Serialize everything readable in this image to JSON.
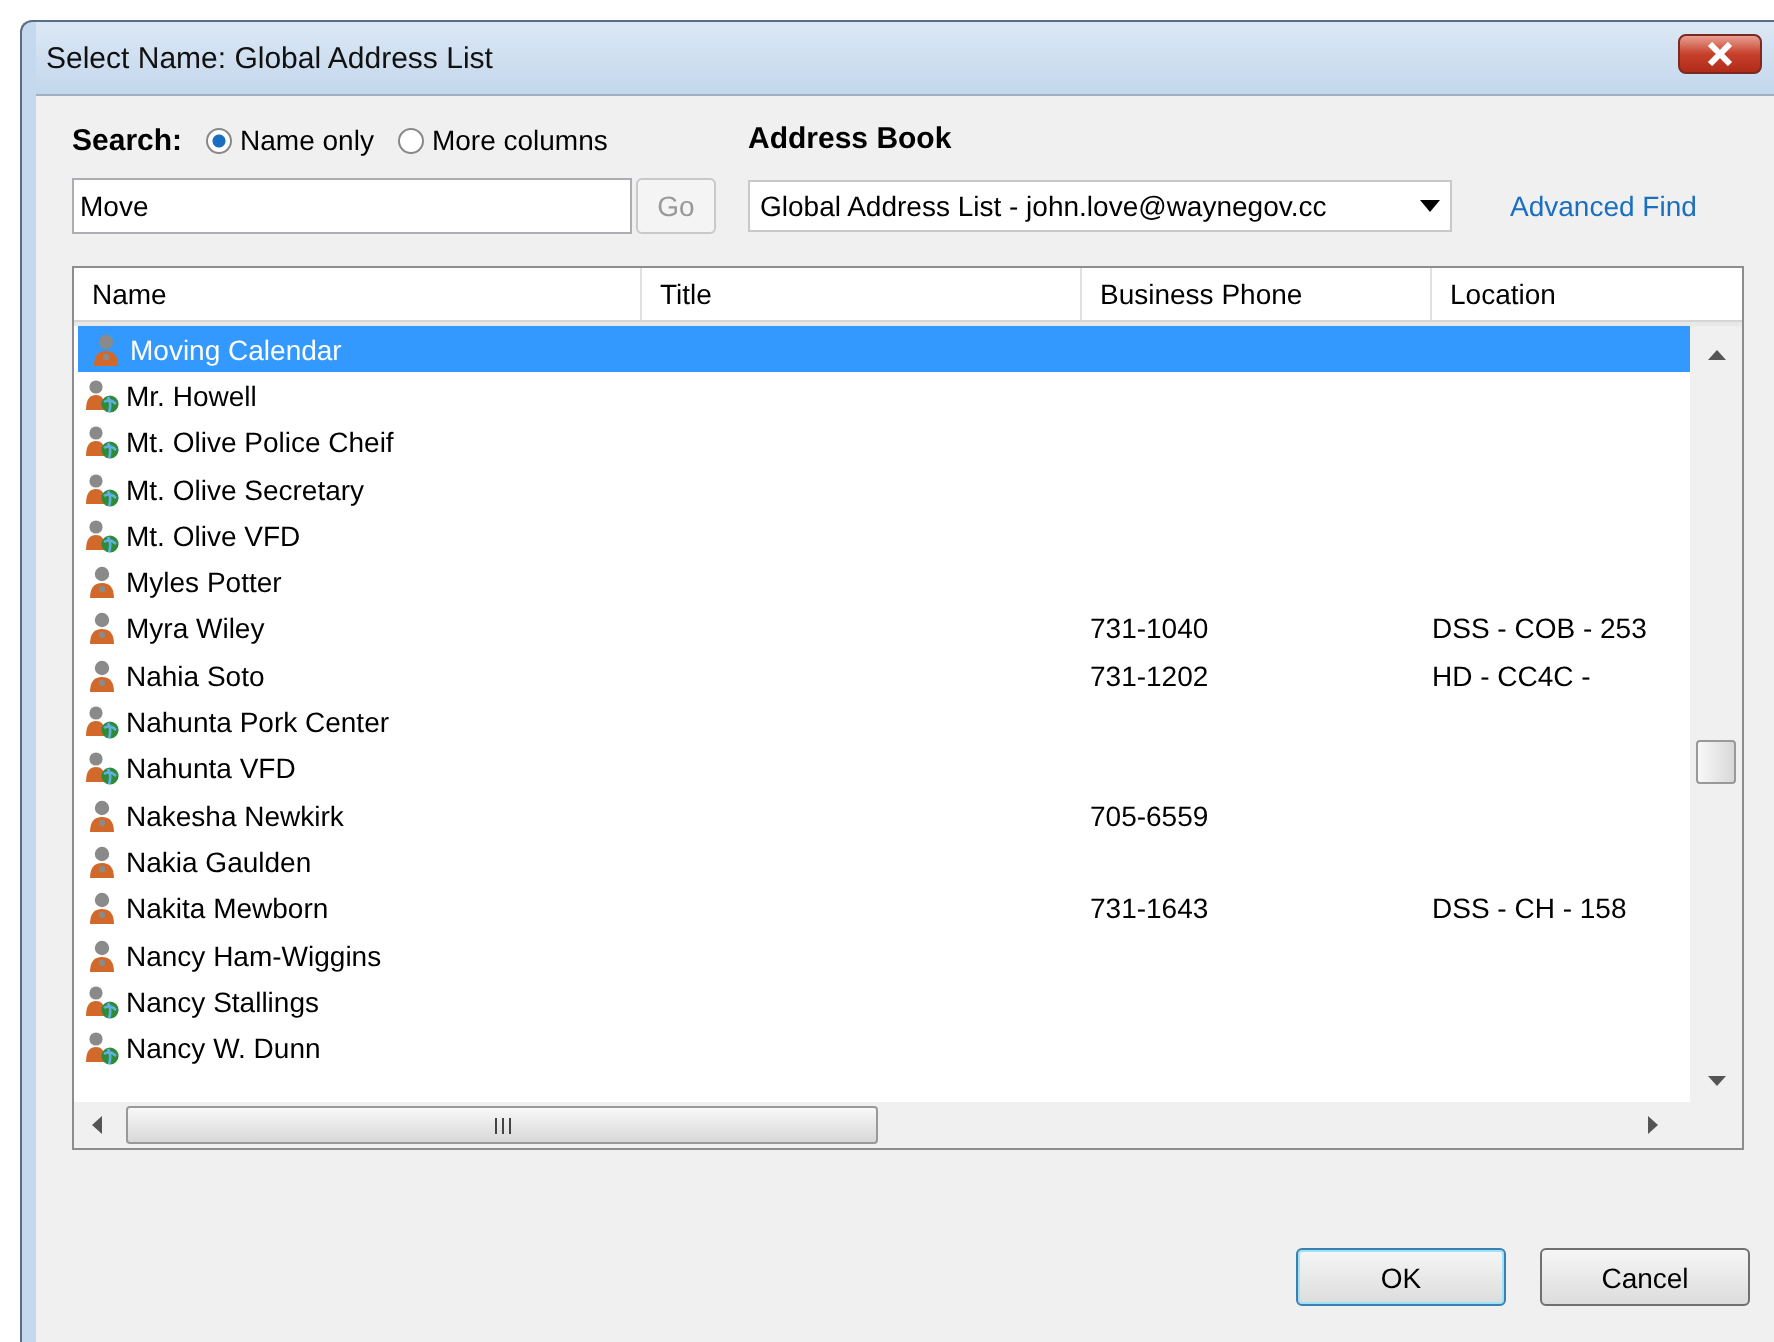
{
  "window": {
    "title": "Select Name: Global Address List"
  },
  "search": {
    "label": "Search:",
    "options": [
      {
        "label": "Name only",
        "selected": true
      },
      {
        "label": "More columns",
        "selected": false
      }
    ],
    "value": "Move",
    "go": "Go"
  },
  "address_book": {
    "label": "Address Book",
    "value": "Global Address List - john.love@waynegov.cc",
    "advanced_find": "Advanced Find"
  },
  "table": {
    "columns": [
      "Name",
      "Title",
      "Business Phone",
      "Location"
    ],
    "rows": [
      {
        "kind": "user",
        "name": "Moving Calendar",
        "phone": "",
        "location": "",
        "selected": true
      },
      {
        "kind": "contact",
        "name": "Mr. Howell",
        "phone": "",
        "location": "",
        "selected": false
      },
      {
        "kind": "contact",
        "name": "Mt. Olive Police Cheif",
        "phone": "",
        "location": "",
        "selected": false
      },
      {
        "kind": "contact",
        "name": "Mt. Olive Secretary",
        "phone": "",
        "location": "",
        "selected": false
      },
      {
        "kind": "contact",
        "name": "Mt. Olive VFD",
        "phone": "",
        "location": "",
        "selected": false
      },
      {
        "kind": "user",
        "name": "Myles Potter",
        "phone": "",
        "location": "",
        "selected": false
      },
      {
        "kind": "user",
        "name": "Myra Wiley",
        "phone": "731-1040",
        "location": "DSS - COB - 253",
        "selected": false
      },
      {
        "kind": "user",
        "name": "Nahia Soto",
        "phone": "731-1202",
        "location": "HD - CC4C -",
        "selected": false
      },
      {
        "kind": "contact",
        "name": "Nahunta Pork Center",
        "phone": "",
        "location": "",
        "selected": false
      },
      {
        "kind": "contact",
        "name": "Nahunta VFD",
        "phone": "",
        "location": "",
        "selected": false
      },
      {
        "kind": "user",
        "name": "Nakesha Newkirk",
        "phone": "705-6559",
        "location": "",
        "selected": false
      },
      {
        "kind": "user",
        "name": "Nakia Gaulden",
        "phone": "",
        "location": "",
        "selected": false
      },
      {
        "kind": "user",
        "name": "Nakita Mewborn",
        "phone": "731-1643",
        "location": "DSS - CH - 158",
        "selected": false
      },
      {
        "kind": "user",
        "name": "Nancy Ham-Wiggins",
        "phone": "",
        "location": "",
        "selected": false
      },
      {
        "kind": "contact",
        "name": "Nancy Stallings",
        "phone": "",
        "location": "",
        "selected": false
      },
      {
        "kind": "contact",
        "name": "Nancy W. Dunn",
        "phone": "",
        "location": "",
        "selected": false
      }
    ]
  },
  "buttons": [
    "OK",
    "Cancel"
  ]
}
